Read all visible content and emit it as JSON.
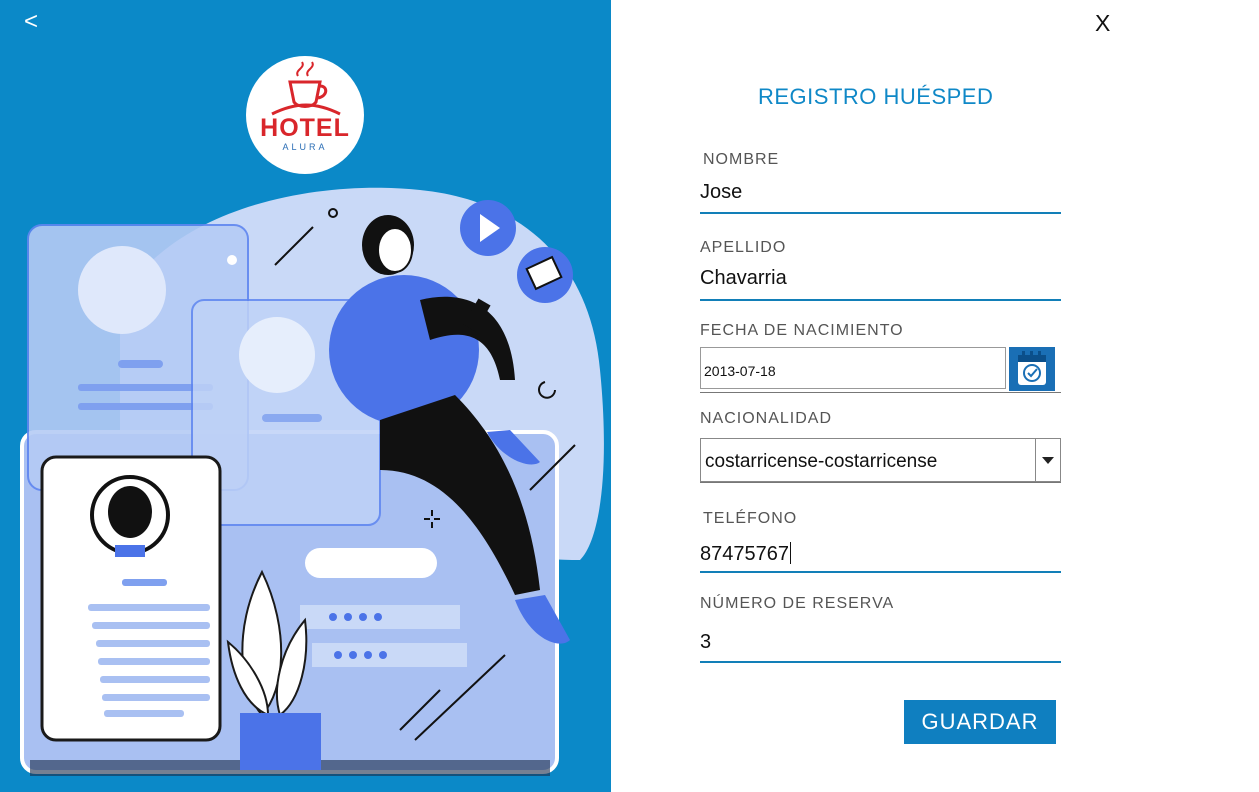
{
  "nav": {
    "back_label": "<",
    "close_label": "X"
  },
  "logo": {
    "word": "HOTEL",
    "sub": "ALURA"
  },
  "form": {
    "title": "REGISTRO HUÉSPED",
    "nombre": {
      "label": "NOMBRE",
      "value": "Jose"
    },
    "apellido": {
      "label": "APELLIDO",
      "value": "Chavarria"
    },
    "fecha": {
      "label": "FECHA DE NACIMIENTO",
      "value": "2013-07-18"
    },
    "nacionalidad": {
      "label": "NACIONALIDAD",
      "value": "costarricense-costarricense"
    },
    "telefono": {
      "label": "TELÉFONO",
      "value": "87475767"
    },
    "reserva": {
      "label": "NÚMERO DE RESERVA",
      "value": "3"
    },
    "save_label": "GUARDAR"
  },
  "colors": {
    "panel_blue": "#0b89c8",
    "accent": "#0f88c7",
    "button": "#0f7fc0"
  }
}
